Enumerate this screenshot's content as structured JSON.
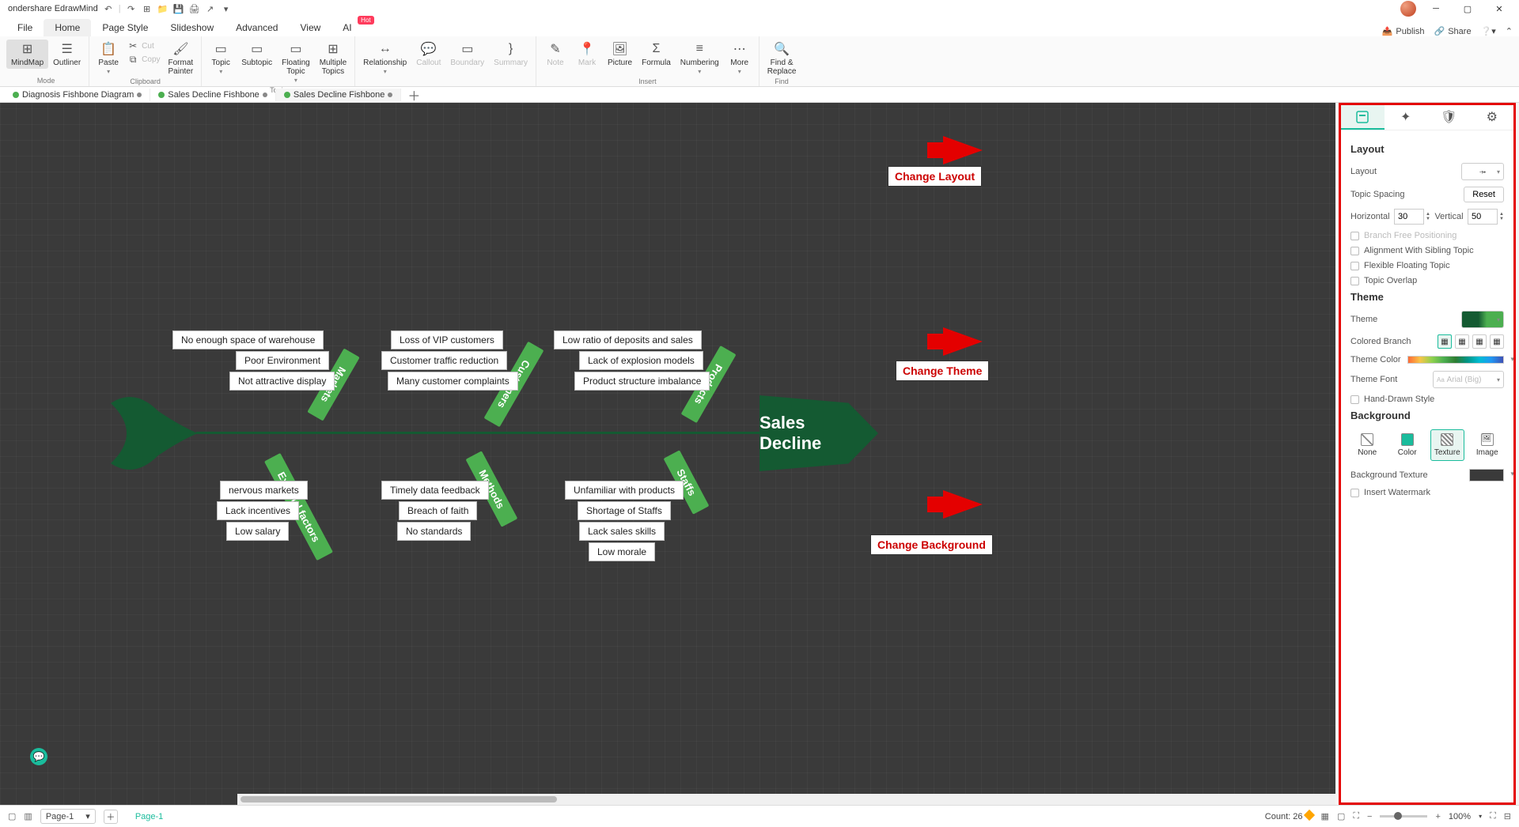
{
  "app": {
    "title": "ondershare EdrawMind"
  },
  "menubar": {
    "items": [
      "File",
      "Home",
      "Page Style",
      "Slideshow",
      "Advanced",
      "View"
    ],
    "ai": "AI",
    "ai_badge": "Hot",
    "right": {
      "publish": "Publish",
      "share": "Share"
    }
  },
  "ribbon": {
    "mode": {
      "label": "Mode",
      "mindmap": "MindMap",
      "outliner": "Outliner"
    },
    "clipboard": {
      "label": "Clipboard",
      "paste": "Paste",
      "cut": "Cut",
      "copy": "Copy",
      "format_painter": "Format\nPainter"
    },
    "topic": {
      "label": "Topic",
      "topic": "Topic",
      "subtopic": "Subtopic",
      "floating": "Floating\nTopic",
      "multiple": "Multiple\nTopics"
    },
    "relationship": "Relationship",
    "callout": "Callout",
    "boundary": "Boundary",
    "summary": "Summary",
    "insert": {
      "label": "Insert",
      "note": "Note",
      "mark": "Mark",
      "picture": "Picture",
      "formula": "Formula",
      "numbering": "Numbering",
      "more": "More"
    },
    "find": {
      "label": "Find",
      "find_replace": "Find &\nReplace"
    }
  },
  "doctabs": [
    {
      "name": "Diagnosis Fishbone Diagram"
    },
    {
      "name": "Sales Decline Fishbone"
    },
    {
      "name": "Sales Decline Fishbone"
    }
  ],
  "fishbone": {
    "head": "Sales Decline",
    "top_bones": [
      {
        "label": "Markets",
        "causes": [
          "No enough space of warehouse",
          "Poor Environment",
          "Not attractive display"
        ]
      },
      {
        "label": "Customers",
        "causes": [
          "Loss of VIP customers",
          "Customer traffic reduction",
          "Many customer complaints"
        ]
      },
      {
        "label": "Products",
        "causes": [
          "Low ratio of deposits and sales",
          "Lack of explosion models",
          "Product structure imbalance"
        ]
      }
    ],
    "bottom_bones": [
      {
        "label": "External factors",
        "causes": [
          "nervous markets",
          "Lack incentives",
          "Low salary"
        ]
      },
      {
        "label": "Methods",
        "causes": [
          "Timely data feedback",
          "Breach of faith",
          "No standards"
        ]
      },
      {
        "label": "Staffs",
        "causes": [
          "Unfamiliar with products",
          "Shortage of Staffs",
          "Lack sales skills",
          "Low morale"
        ]
      }
    ]
  },
  "annotations": {
    "layout": "Change Layout",
    "theme": "Change Theme",
    "background": "Change Background"
  },
  "panel": {
    "layout": {
      "title": "Layout",
      "layout_label": "Layout",
      "topic_spacing": "Topic Spacing",
      "reset": "Reset",
      "horizontal": "Horizontal",
      "horizontal_val": "30",
      "vertical": "Vertical",
      "vertical_val": "50",
      "branch_free": "Branch Free Positioning",
      "align_sibling": "Alignment With Sibling Topic",
      "flexible_floating": "Flexible Floating Topic",
      "topic_overlap": "Topic Overlap"
    },
    "theme": {
      "title": "Theme",
      "theme_label": "Theme",
      "colored_branch": "Colored Branch",
      "theme_color": "Theme Color",
      "theme_font": "Theme Font",
      "theme_font_val": "Arial (Big)",
      "hand_drawn": "Hand-Drawn Style"
    },
    "background": {
      "title": "Background",
      "none": "None",
      "color": "Color",
      "texture": "Texture",
      "image": "Image",
      "bg_texture": "Background Texture",
      "insert_watermark": "Insert Watermark"
    }
  },
  "statusbar": {
    "page_sel": "Page-1",
    "page_tab": "Page-1",
    "count_label": "Count:",
    "count_val": "26",
    "zoom": "100%"
  }
}
